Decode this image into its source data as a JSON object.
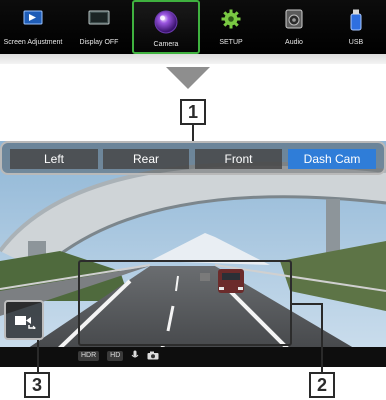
{
  "launcher": {
    "items": [
      {
        "label": "Screen Adjustment",
        "icon": "screen-adjustment-icon"
      },
      {
        "label": "Display OFF",
        "icon": "display-off-icon"
      },
      {
        "label": "Camera",
        "icon": "camera-icon",
        "active": true
      },
      {
        "label": "SETUP",
        "icon": "setup-gear-icon"
      },
      {
        "label": "Audio",
        "icon": "audio-speaker-icon"
      },
      {
        "label": "USB",
        "icon": "usb-icon"
      }
    ],
    "active_color": "#3fb13f"
  },
  "camera_tabs": {
    "items": [
      "Left",
      "Rear",
      "Front",
      "Dash Cam"
    ],
    "selected": "Dash Cam",
    "selected_color": "#2f7dd8"
  },
  "callouts": {
    "one": "1",
    "two": "2",
    "three": "3"
  },
  "status_bar": {
    "hdr": "HDR",
    "hd": "HD",
    "icons": [
      "microphone-icon",
      "camera-snapshot-icon"
    ]
  },
  "camera_view_button": {
    "icon": "camera-view-switch-icon"
  }
}
